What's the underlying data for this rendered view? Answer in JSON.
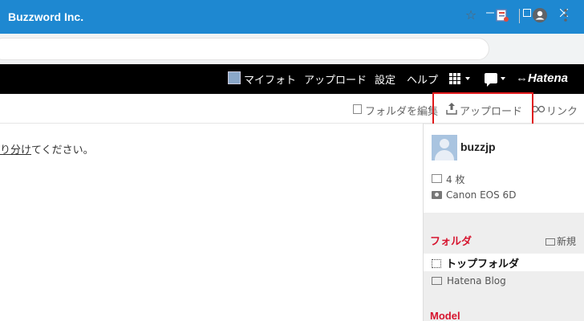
{
  "window": {
    "title": "Buzzword Inc."
  },
  "navbar": {
    "my_photo": "マイフォト",
    "upload": "アップロード",
    "settings": "設定",
    "help": "ヘルプ",
    "brand": "Hatena"
  },
  "toolbar": {
    "edit_folder": "フォルダを編集",
    "upload": "アップロード",
    "link": "リンク"
  },
  "main": {
    "message_link": "り分け",
    "message_rest": "てください。"
  },
  "sidebar": {
    "username": "buzzjp",
    "photo_count": "4 枚",
    "camera": "Canon EOS 6D",
    "folders_heading": "フォルダ",
    "new_label": "新規",
    "folders": [
      {
        "name": "トップフォルダ"
      },
      {
        "name": "Hatena Blog"
      }
    ],
    "model_heading": "Model"
  },
  "colors": {
    "titlebar": "#1e88d1",
    "navbar": "#000000",
    "accent_red": "#d6142e",
    "highlight": "#e0191b"
  }
}
